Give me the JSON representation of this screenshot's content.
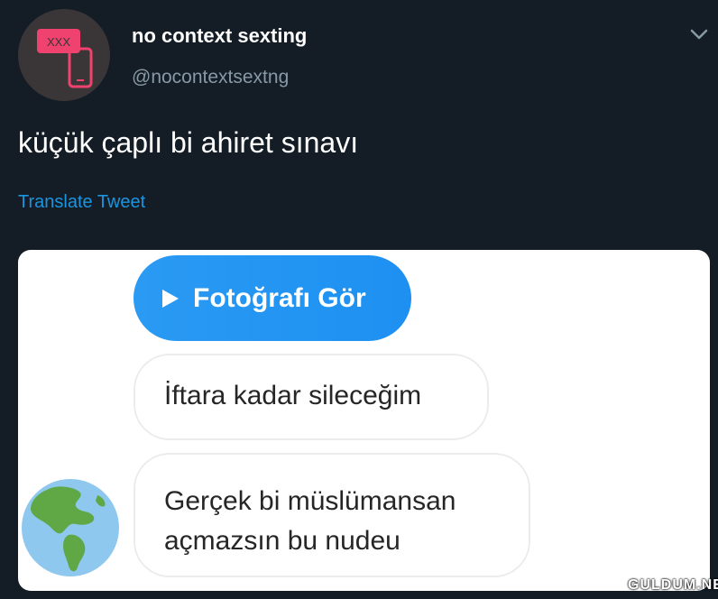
{
  "tweet": {
    "avatar_text": "XXX",
    "display_name": "no context sexting",
    "handle": "@nocontextsextng",
    "text": "küçük çaplı bi ahiret sınavı",
    "translate_label": "Translate Tweet",
    "menu_icon": "chevron-down-icon"
  },
  "media": {
    "view_photo_label": "Fotoğrafı Gör",
    "play_icon": "play-icon",
    "messages": [
      "İftara kadar sileceğim",
      "Gerçek bi müslümansan açmazsın bu nudeu"
    ],
    "sender_avatar": "globe-icon"
  },
  "watermark": "GULDUM.NET",
  "colors": {
    "background": "#141d26",
    "link": "#1b95e0",
    "button": "#1d90f2",
    "logo_pink": "#f0426e"
  }
}
